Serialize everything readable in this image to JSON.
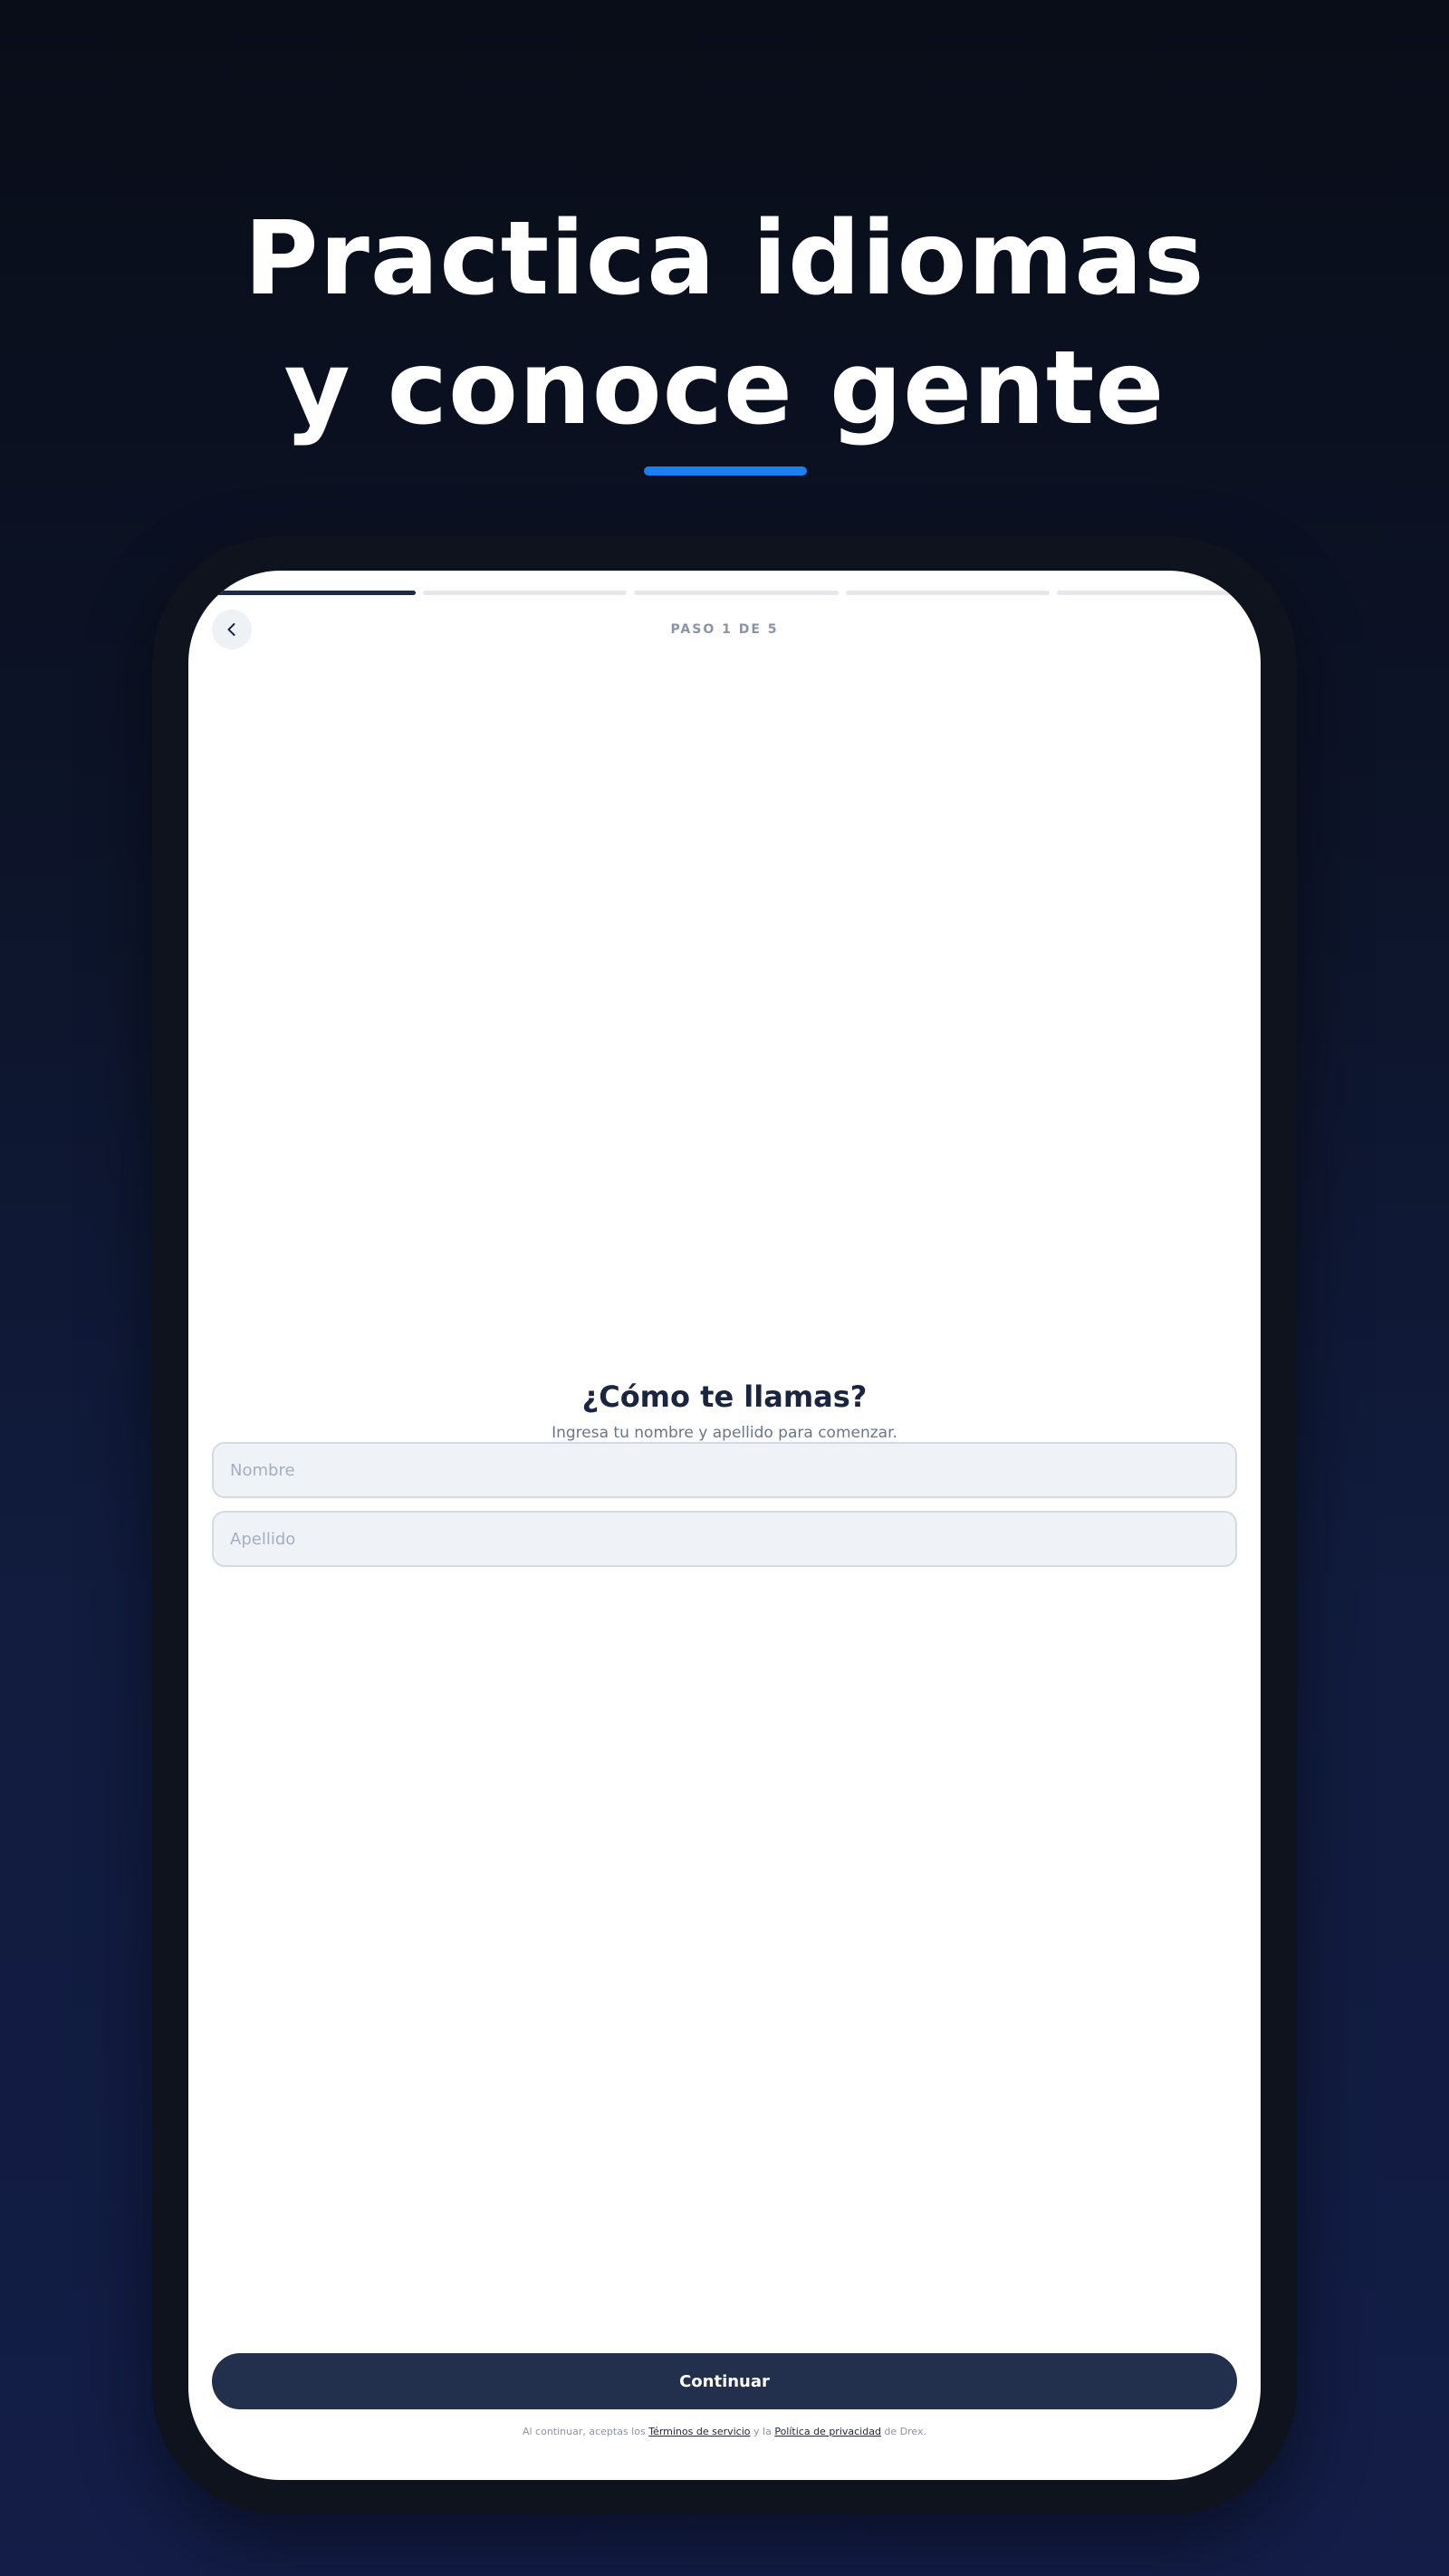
{
  "hero": {
    "title_line_1": "Practica idiomas",
    "title_line_2": "y conoce gente"
  },
  "progress": {
    "current_step": 1,
    "total_steps": 5
  },
  "header": {
    "back_icon": "chevron-left-icon",
    "step_label": "PASO 1 DE 5"
  },
  "form": {
    "title": "¿Cómo te llamas?",
    "subtitle": "Ingresa tu nombre y apellido para comenzar.",
    "first_name": {
      "value": "",
      "placeholder": "Nombre"
    },
    "last_name": {
      "value": "",
      "placeholder": "Apellido"
    }
  },
  "footer": {
    "continue_label": "Continuar",
    "legal_prefix": "Al continuar, aceptas los ",
    "terms_link": "Términos de servicio",
    "legal_middle": " y la ",
    "privacy_link": "Política de privacidad",
    "legal_suffix": " de Drex."
  },
  "colors": {
    "background_dark": "#090d18",
    "background_navy": "#131d47",
    "accent_blue": "#1a7ff0",
    "primary_button": "#22304e",
    "progress_active": "#1f2a44",
    "progress_inactive": "#e4e7eb",
    "input_background": "#eff2f7"
  }
}
